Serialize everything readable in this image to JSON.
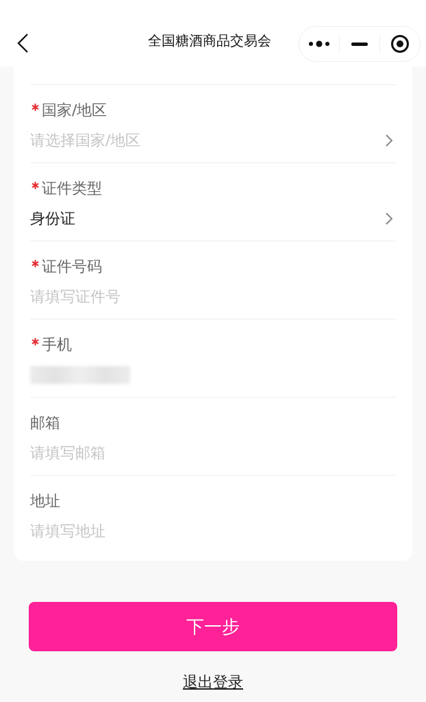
{
  "nav_bar": {
    "title": "全国糖酒商品交易会"
  },
  "fields": [
    {
      "label": "国家/地区",
      "required": true,
      "kind": "select",
      "placeholder": "请选择国家/地区"
    },
    {
      "label": "证件类型",
      "required": true,
      "kind": "select",
      "value": "身份证"
    },
    {
      "label": "证件号码",
      "required": true,
      "kind": "input",
      "placeholder": "请填写证件号"
    },
    {
      "label": "手机",
      "required": true,
      "kind": "redacted"
    },
    {
      "label": "邮箱",
      "required": false,
      "kind": "input",
      "placeholder": "请填写邮箱"
    },
    {
      "label": "地址",
      "required": false,
      "kind": "input",
      "placeholder": "请填写地址"
    }
  ],
  "next_button": "下一步",
  "logout_link": "退出登录"
}
